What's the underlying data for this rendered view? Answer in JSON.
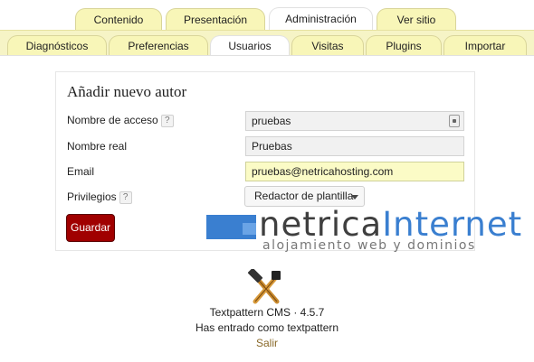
{
  "primary_tabs": [
    {
      "label": "Contenido",
      "active": false
    },
    {
      "label": "Presentación",
      "active": false
    },
    {
      "label": "Administración",
      "active": true
    },
    {
      "label": "Ver sitio",
      "active": false
    }
  ],
  "secondary_tabs": [
    {
      "label": "Diagnósticos",
      "active": false
    },
    {
      "label": "Preferencias",
      "active": false
    },
    {
      "label": "Usuarios",
      "active": true
    },
    {
      "label": "Visitas",
      "active": false
    },
    {
      "label": "Plugins",
      "active": false
    },
    {
      "label": "Importar",
      "active": false
    }
  ],
  "form": {
    "title": "Añadir nuevo autor",
    "username_label": "Nombre de acceso",
    "username_value": "pruebas",
    "realname_label": "Nombre real",
    "realname_value": "Pruebas",
    "email_label": "Email",
    "email_value": "pruebas@netricahosting.com",
    "privileges_label": "Privilegios",
    "privileges_value": "Redactor de plantilla",
    "help_glyph": "?",
    "save_label": "Guardar"
  },
  "watermark": {
    "name_part1": "netrica",
    "name_part2": "Internet",
    "tagline": "alojamiento web y dominios"
  },
  "footer": {
    "version": "Textpattern CMS · 4.5.7",
    "logged_in": "Has entrado como textpattern",
    "logout": "Salir"
  },
  "colors": {
    "tab_bg": "#f8f6b8",
    "save_button": "#a00000",
    "email_highlight": "#fbfbc6",
    "brand_blue": "#3a7fd0"
  }
}
